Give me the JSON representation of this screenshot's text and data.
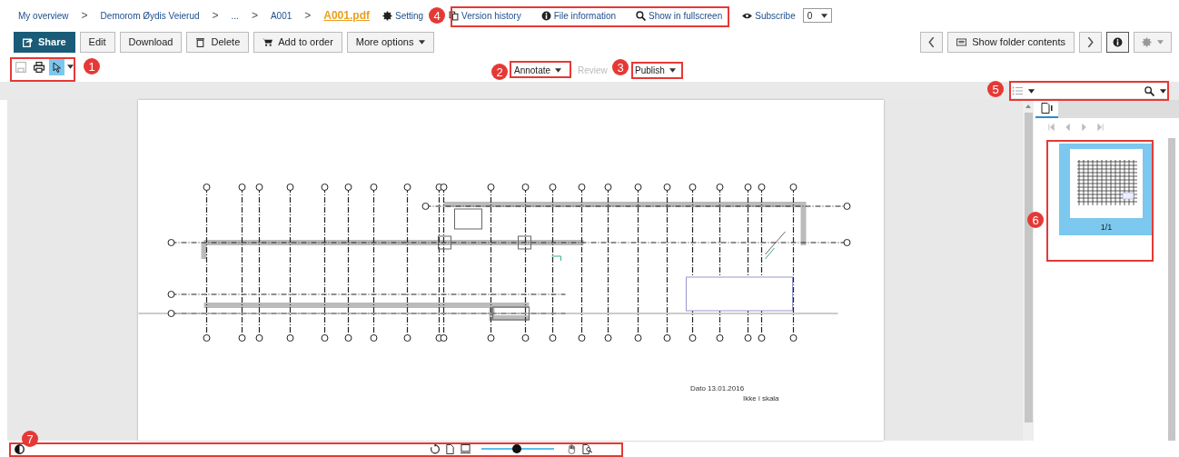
{
  "breadcrumb": [
    {
      "kind": "link",
      "label": "My overview"
    },
    {
      "kind": "separator",
      "label": ">"
    },
    {
      "kind": "link",
      "label": "Demorom Øydis Veierud"
    },
    {
      "kind": "separator",
      "label": ">"
    },
    {
      "kind": "link",
      "label": "..."
    },
    {
      "kind": "separator",
      "label": ">"
    },
    {
      "kind": "link",
      "label": "A001"
    },
    {
      "kind": "separator",
      "label": ">"
    },
    {
      "kind": "current",
      "label": "A001.pdf"
    }
  ],
  "header_links": [
    {
      "kind": "gear",
      "label": "Setting"
    },
    {
      "kind": "history",
      "label": "Version history"
    },
    {
      "kind": "info",
      "label": "File information"
    },
    {
      "kind": "zoom",
      "label": "Show in fullscreen"
    },
    {
      "kind": "eye",
      "label": "Subscribe"
    }
  ],
  "subscribe_select": {
    "value": "0"
  },
  "actions": [
    {
      "kind": "share",
      "label": "Share",
      "primary": true
    },
    {
      "kind": "plain",
      "label": "Edit",
      "primary": false
    },
    {
      "kind": "plain",
      "label": "Download",
      "primary": false
    },
    {
      "kind": "trash",
      "label": "Delete",
      "primary": false
    },
    {
      "kind": "cart",
      "label": "Add to order",
      "primary": false
    },
    {
      "kind": "menu",
      "label": "More options",
      "primary": false
    }
  ],
  "folder_button": {
    "label": "Show folder contents"
  },
  "viewer_tools": [
    {
      "kind": "save",
      "disabled": true,
      "selected": false
    },
    {
      "kind": "print",
      "disabled": false,
      "selected": false
    },
    {
      "kind": "pointer",
      "disabled": false,
      "selected": true
    }
  ],
  "modes": [
    {
      "label": "Annotate",
      "disabled": false,
      "dropdown": true
    },
    {
      "label": "Review",
      "disabled": true,
      "dropdown": false
    },
    {
      "label": "Publish",
      "disabled": false,
      "dropdown": true
    }
  ],
  "title_block": {
    "date": "Dato 13.01.2016",
    "scale": "Ikke i skala"
  },
  "thumbnails": [
    {
      "label": "1/1",
      "selected": true
    }
  ],
  "zoom_slider": {
    "level": 0.49
  },
  "callouts": [
    {
      "number": "1"
    },
    {
      "number": "2"
    },
    {
      "number": "3"
    },
    {
      "number": "4"
    },
    {
      "number": "5"
    },
    {
      "number": "6"
    },
    {
      "number": "7"
    }
  ]
}
